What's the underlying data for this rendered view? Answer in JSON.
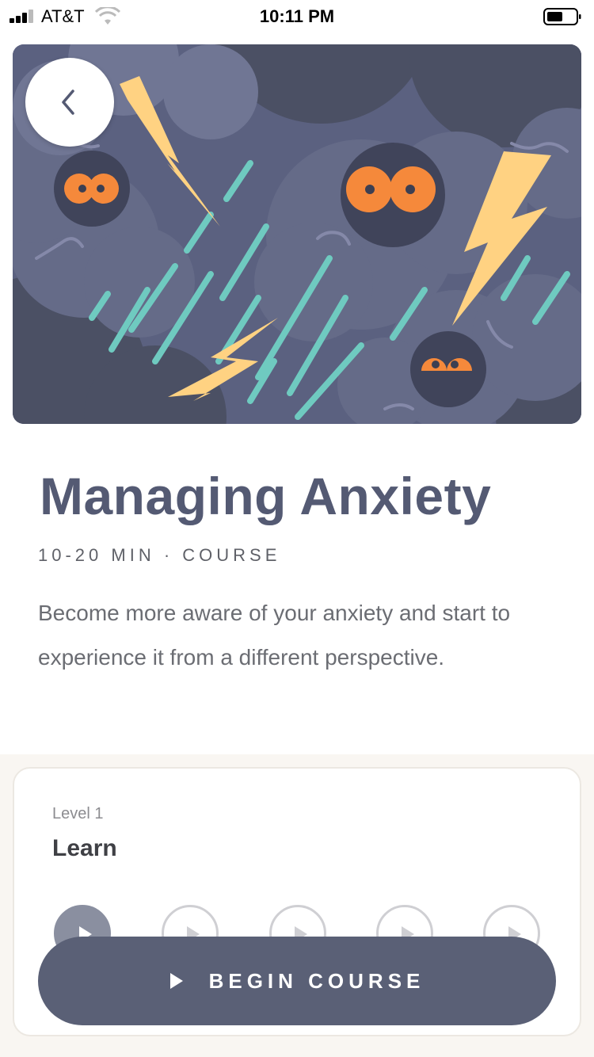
{
  "status_bar": {
    "carrier": "AT&T",
    "time": "10:11 PM"
  },
  "colors": {
    "primary": "#545a73",
    "button": "#5a6076",
    "lightning": "#ffd282",
    "rain": "#6fcac0",
    "eyes": "#f5893b"
  },
  "icons": {
    "back": "chevron-left-icon",
    "play": "play-icon"
  },
  "course": {
    "title": "Managing Anxiety",
    "meta": "10-20 MIN · COURSE",
    "description": "Become more aware of your anxiety and start to experience it from a different perspective."
  },
  "level": {
    "label": "Level 1",
    "name": "Learn",
    "sessions_visible": 5,
    "active_session": 1
  },
  "cta": {
    "label": "BEGIN COURSE"
  }
}
